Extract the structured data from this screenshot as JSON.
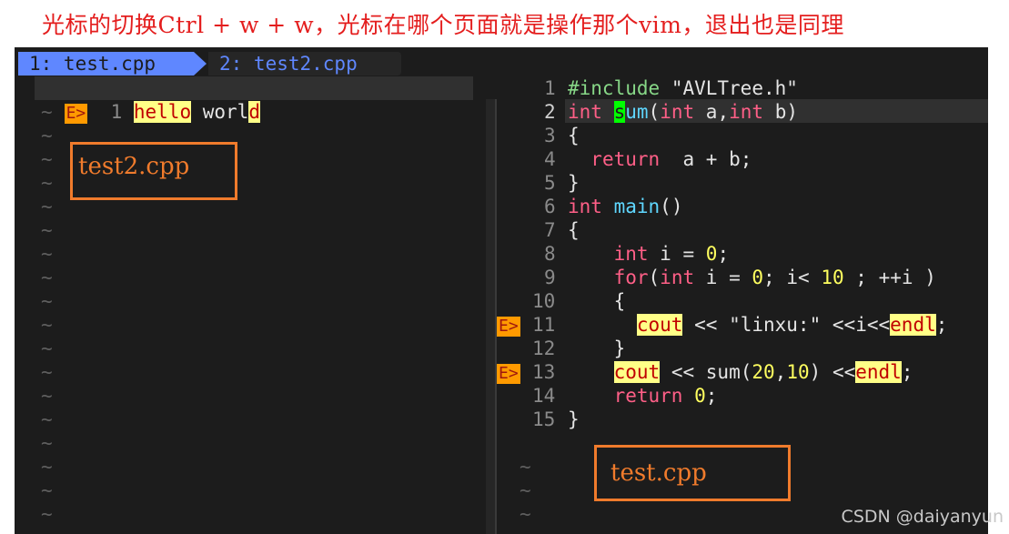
{
  "caption": "光标的切换Ctrl + w + w，光标在哪个页面就是操作那个vim，退出也是同理",
  "tabs": [
    {
      "label": "1: test.cpp",
      "active": true
    },
    {
      "label": "2: test2.cpp",
      "active": false
    }
  ],
  "left_pane": {
    "file": "test2.cpp",
    "lines": [
      {
        "num": "1",
        "sign": "E>",
        "hl1": "hello",
        "plain": "worl",
        "hl2": "d"
      }
    ],
    "tilde": "~"
  },
  "right_pane": {
    "file": "test.cpp",
    "lines": [
      {
        "num": "1",
        "text": "#include \"AVLTree.h\""
      },
      {
        "num": "2",
        "text": "int sum(int a,int b)"
      },
      {
        "num": "3",
        "text": "{"
      },
      {
        "num": "4",
        "text": "  return  a + b;"
      },
      {
        "num": "5",
        "text": "}"
      },
      {
        "num": "6",
        "text": "int main()"
      },
      {
        "num": "7",
        "text": "{"
      },
      {
        "num": "8",
        "text": "    int i = 0;"
      },
      {
        "num": "9",
        "text": "    for(int i = 0; i< 10 ; ++i )"
      },
      {
        "num": "10",
        "text": "    {"
      },
      {
        "num": "11",
        "sign": "E>",
        "text": "      cout << \"linxu:\" <<i<<endl;"
      },
      {
        "num": "12",
        "text": "    }"
      },
      {
        "num": "13",
        "sign": "E>",
        "text": "    cout << sum(20,10) <<endl;"
      },
      {
        "num": "14",
        "text": "    return 0;"
      },
      {
        "num": "15",
        "text": "}"
      }
    ],
    "tilde": "~"
  },
  "annotations": {
    "left_label": "test2.cpp",
    "right_label": "test.cpp",
    "color": "#f07b2c"
  },
  "watermark": "CSDN @daiyanyun",
  "colors": {
    "background": "#1c1c1c",
    "tab_active": "#5f87ff",
    "keyword": "#ff5f87",
    "function": "#5fd7ff",
    "number": "#ffff5f",
    "error_sign": "#ff9a00",
    "highlight": "#ffff87"
  }
}
